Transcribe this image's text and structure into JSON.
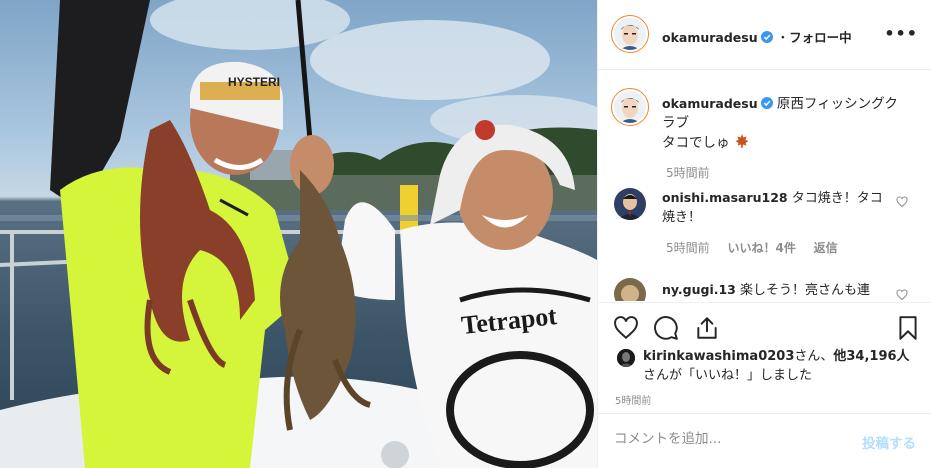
{
  "header": {
    "username": "okamuradesu",
    "separator": "・",
    "follow_status": "フォロー中",
    "more_glyph": "•••"
  },
  "caption": {
    "username": "okamuradesu",
    "line1": "原西フィッシングクラブ",
    "line2": "タコでしゅ",
    "emoji_icon": "maple-leaf-icon",
    "time": "5時間前"
  },
  "comments": [
    {
      "username": "onishi.masaru128",
      "text": "タコ焼き！タコ焼き！",
      "time": "5時間前",
      "likes": "いいね！4件",
      "reply": "返信"
    },
    {
      "username": "ny.gugi.13",
      "text": "楽しそう！亮さんも連"
    }
  ],
  "likes": {
    "user": "kirinkawashima0203",
    "suffix1": "さん、",
    "others": "他34,196人",
    "suffix2": "さんが「いいね！」しました"
  },
  "post_time": "5時間前",
  "add_comment": {
    "placeholder": "コメントを追加...",
    "post_label": "投稿する"
  },
  "photo": {
    "cap_left_text": "HYSTERI",
    "shirt_right_text": "Tetrapot"
  },
  "colors": {
    "verified": "#3897f0",
    "post_button": "#b2dffc",
    "meta_gray": "#8e8e8e",
    "neon_shirt": "#d4f53a"
  }
}
